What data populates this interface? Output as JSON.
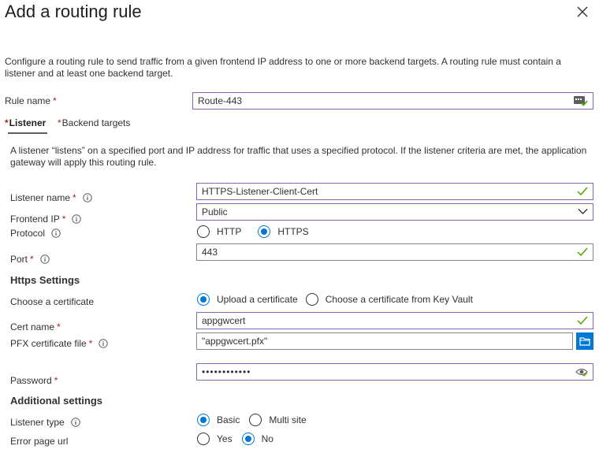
{
  "panel": {
    "title": "Add a routing rule",
    "description": "Configure a routing rule to send traffic from a given frontend IP address to one or more backend targets. A routing rule must contain a listener and at least one backend target."
  },
  "rule_name": {
    "label": "Rule name",
    "value": "Route-443"
  },
  "tabs": [
    {
      "label": "Listener",
      "active": true,
      "required": true
    },
    {
      "label": "Backend targets",
      "active": false,
      "required": true
    }
  ],
  "listener": {
    "description": "A listener “listens” on a specified port and IP address for traffic that uses a specified protocol. If the listener criteria are met, the application gateway will apply this routing rule.",
    "listener_name": {
      "label": "Listener name",
      "value": "HTTPS-Listener-Client-Cert"
    },
    "frontend_ip": {
      "label": "Frontend IP",
      "value": "Public"
    },
    "protocol": {
      "label": "Protocol",
      "options": [
        "HTTP",
        "HTTPS"
      ],
      "selected": "HTTPS"
    },
    "port": {
      "label": "Port",
      "value": "443"
    },
    "https_settings_heading": "Https Settings",
    "choose_certificate": {
      "label": "Choose a certificate",
      "options": [
        "Upload a certificate",
        "Choose a certificate from Key Vault"
      ],
      "selected": "Upload a certificate"
    },
    "cert_name": {
      "label": "Cert name",
      "value": "appgwcert"
    },
    "pfx_file": {
      "label": "PFX certificate file",
      "value": "\"appgwcert.pfx\""
    },
    "password": {
      "label": "Password",
      "value": "••••••••••••"
    },
    "additional_heading": "Additional settings",
    "listener_type": {
      "label": "Listener type",
      "options": [
        "Basic",
        "Multi site"
      ],
      "selected": "Basic"
    },
    "error_page_url": {
      "label": "Error page url",
      "options": [
        "Yes",
        "No"
      ],
      "selected": "No"
    }
  },
  "icons": {
    "info": "info-icon",
    "check": "checkmark-icon",
    "close": "close-icon",
    "dropdown": "chevron-down-icon",
    "folder": "folder-icon",
    "reveal": "eye-icon",
    "autofill": "password-manager-icon"
  },
  "colors": {
    "accent": "#0078d4",
    "focus_border": "#8764b8",
    "valid_check": "#57a300",
    "required": "#a4262c"
  }
}
